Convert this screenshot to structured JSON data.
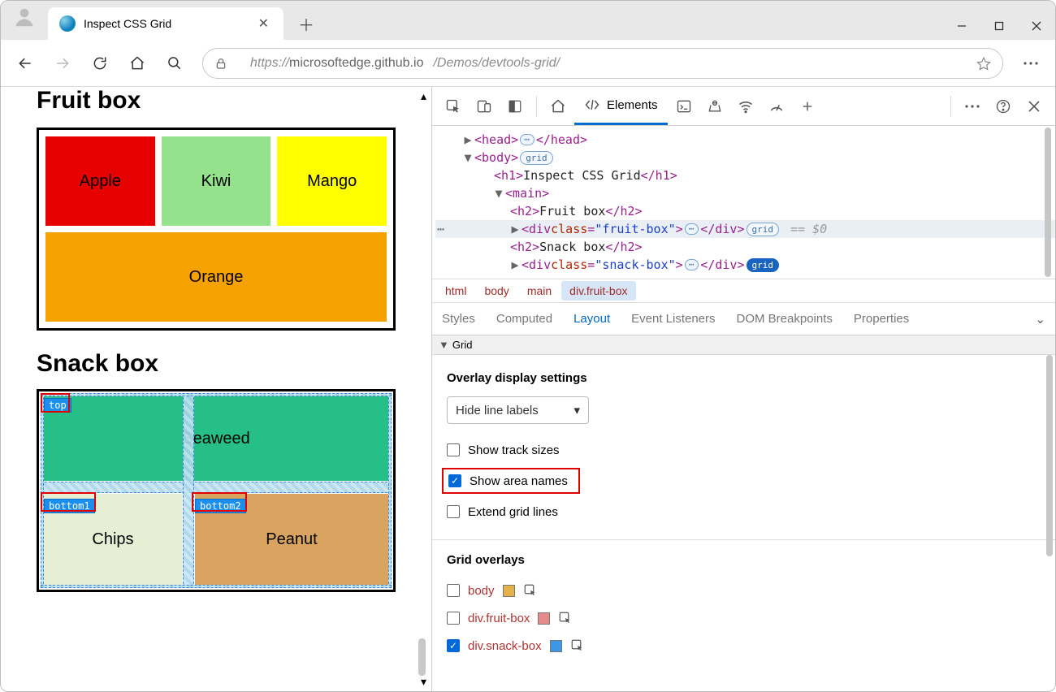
{
  "window": {
    "tab_title": "Inspect CSS Grid"
  },
  "address": {
    "scheme": "https://",
    "host": "microsoftedge.github.io",
    "path": "/Demos/devtools-grid/"
  },
  "page": {
    "fruit_heading": "Fruit box",
    "fruit_items": {
      "apple": "Apple",
      "kiwi": "Kiwi",
      "mango": "Mango",
      "orange": "Orange"
    },
    "snack_heading": "Snack box",
    "snack_items": {
      "seaweed": "Seaweed",
      "chips": "Chips",
      "peanut": "Peanut"
    },
    "area_labels": {
      "top": "top",
      "bottom1": "bottom1",
      "bottom2": "bottom2"
    }
  },
  "devtools": {
    "tab_elements": "Elements",
    "dom": {
      "head_open": "head",
      "head_close": "/head",
      "body_open": "body",
      "h1_open": "h1",
      "h1_text": "Inspect CSS Grid",
      "h1_close": "/h1",
      "main_open": "main",
      "h2a_open": "h2",
      "h2a_text": "Fruit box",
      "h2a_close": "/h2",
      "div_open": "div",
      "class_k": "class",
      "fruit_cls": "\"fruit-box\"",
      "div_close": "/div",
      "h2b_open": "h2",
      "h2b_text": "Snack box",
      "h2b_close": "/h2",
      "snack_cls": "\"snack-box\"",
      "grid_badge": "grid",
      "sel_hint": "== $0"
    },
    "crumbs": {
      "html": "html",
      "body": "body",
      "main": "main",
      "sel": "div.fruit-box"
    },
    "panel_tabs": {
      "styles": "Styles",
      "computed": "Computed",
      "layout": "Layout",
      "events": "Event Listeners",
      "dom_bp": "DOM Breakpoints",
      "props": "Properties"
    },
    "grid_section": "Grid",
    "overlay_settings": "Overlay display settings",
    "line_labels_select": "Hide line labels",
    "chk_track_sizes": "Show track sizes",
    "chk_area_names": "Show area names",
    "chk_extend": "Extend grid lines",
    "overlays_heading": "Grid overlays",
    "ov_body": "body",
    "ov_fruit": "div.fruit-box",
    "ov_snack": "div.snack-box"
  }
}
